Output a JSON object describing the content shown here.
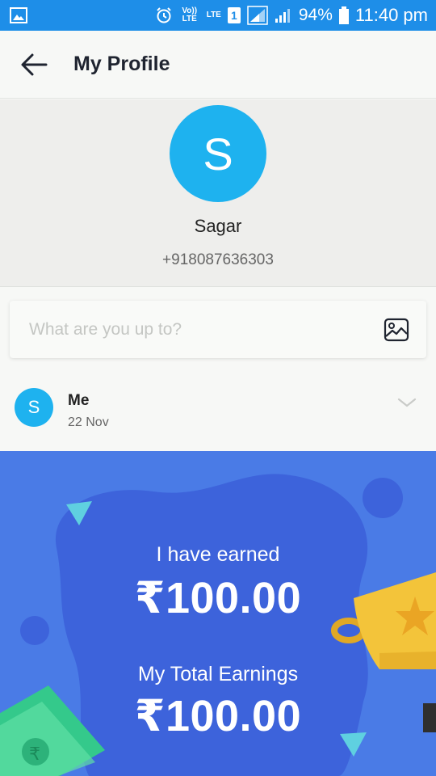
{
  "status_bar": {
    "network_label": "LTE",
    "volte_label": "Vo)) LTE",
    "sim_slot": "1",
    "battery": "94%",
    "time": "11:40 pm"
  },
  "header": {
    "title": "My Profile"
  },
  "profile": {
    "avatar_initial": "S",
    "name": "Sagar",
    "phone": "+918087636303"
  },
  "composer": {
    "placeholder": "What are you up to?"
  },
  "post": {
    "avatar_initial": "S",
    "author": "Me",
    "date": "22 Nov"
  },
  "earnings": {
    "earned_label": "I have earned",
    "earned_value": "₹100.00",
    "total_label": "My Total Earnings",
    "total_value": "₹100.00"
  },
  "colors": {
    "status_bar": "#1e8ee8",
    "avatar": "#1eb2ef",
    "earnings_bg": "#4a7be6",
    "earnings_blob": "#3d63db",
    "accent_teal": "#5fd0e0",
    "trophy": "#f3c43a",
    "money": "#34c98b"
  }
}
